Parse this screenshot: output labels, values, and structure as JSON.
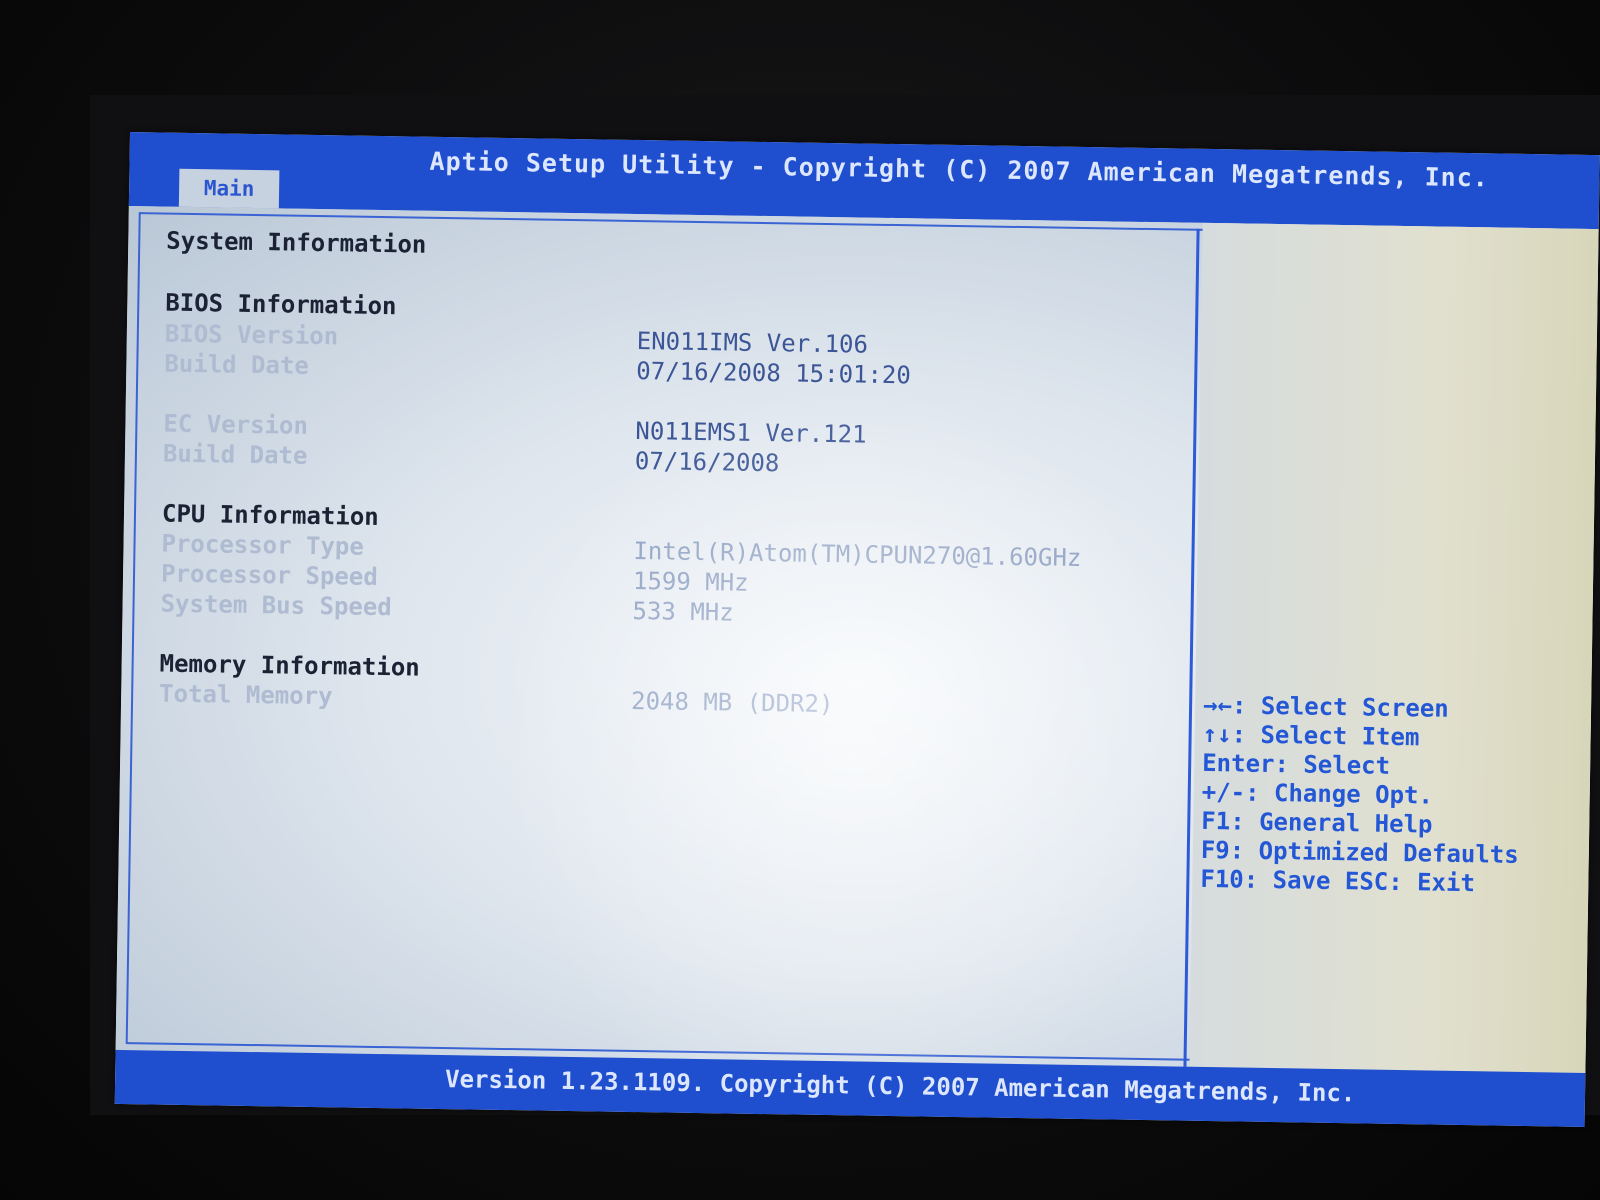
{
  "title_bar": {
    "title": "Aptio Setup Utility - Copyright (C) 2007 American Megatrends, Inc.",
    "active_tab": "Main"
  },
  "main": {
    "page_title": "System Information",
    "bios_section": {
      "heading": "BIOS Information",
      "bios_version_label": "BIOS Version",
      "bios_version_value": "EN011IMS Ver.106",
      "build_date_label": "Build Date",
      "build_date_value": "07/16/2008 15:01:20"
    },
    "ec_section": {
      "ec_version_label": "EC Version",
      "ec_version_value": "N011EMS1 Ver.121",
      "build_date_label": "Build Date",
      "build_date_value": "07/16/2008"
    },
    "cpu_section": {
      "heading": "CPU Information",
      "processor_type_label": "Processor Type",
      "processor_type_value": "Intel(R)Atom(TM)CPUN270@1.60GHz",
      "processor_speed_label": "Processor Speed",
      "processor_speed_value": "1599 MHz",
      "bus_speed_label": "System Bus Speed",
      "bus_speed_value": "533 MHz"
    },
    "memory_section": {
      "heading": "Memory Information",
      "total_memory_label": "Total Memory",
      "total_memory_value": "2048 MB (DDR2)"
    }
  },
  "help": {
    "lines": [
      "→←: Select Screen",
      "↑↓: Select Item",
      "Enter: Select",
      "+/-: Change Opt.",
      "F1: General Help",
      "F9: Optimized Defaults",
      "F10: Save  ESC: Exit"
    ]
  },
  "bottom_bar": {
    "text": "Version 1.23.1109. Copyright (C) 2007 American Megatrends, Inc."
  },
  "colors": {
    "title_bar_blue": "#1f4fcf",
    "help_text_blue": "#2457d6",
    "value_text": "#3b5596",
    "heading_text": "#1a2233"
  }
}
